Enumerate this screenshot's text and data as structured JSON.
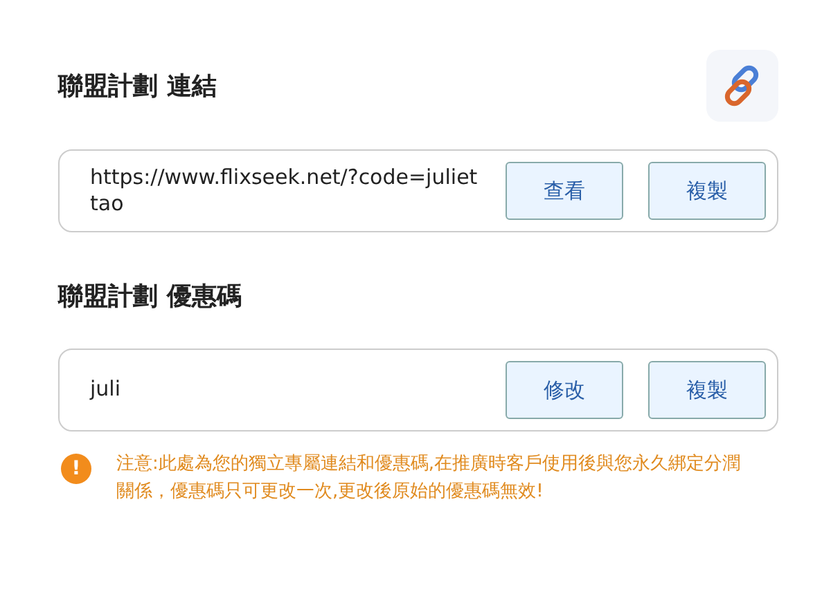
{
  "link_section": {
    "title": "聯盟計劃 連結",
    "value": "https://www.flixseek.net/?code=juliettao",
    "buttons": [
      "查看",
      "複製"
    ]
  },
  "code_section": {
    "title": "聯盟計劃 優惠碼",
    "value": "juli",
    "buttons": [
      "修改",
      "複製"
    ]
  },
  "notice": {
    "icon": "!",
    "text": "注意:此處為您的獨立專屬連結和優惠碼,在推廣時客戶使用後與您永久綁定分潤關係，優惠碼只可更改一次,更改後原始的優惠碼無效!"
  }
}
